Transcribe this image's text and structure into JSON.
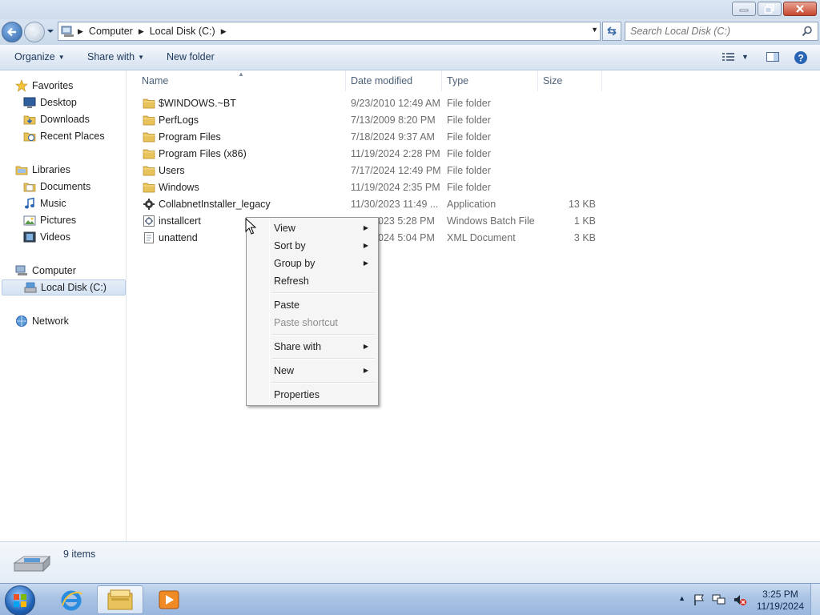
{
  "window": {
    "minimize_icon": "minimize-icon",
    "restore_icon": "restore-icon",
    "close_icon": "close-icon"
  },
  "address": {
    "crumbs": [
      "Computer",
      "Local Disk (C:)"
    ],
    "search_placeholder": "Search Local Disk (C:)"
  },
  "toolbar": {
    "organize": "Organize",
    "share_with": "Share with",
    "new_folder": "New folder"
  },
  "nav": {
    "favorites": "Favorites",
    "desktop": "Desktop",
    "downloads": "Downloads",
    "recent_places": "Recent Places",
    "libraries": "Libraries",
    "documents": "Documents",
    "music": "Music",
    "pictures": "Pictures",
    "videos": "Videos",
    "computer": "Computer",
    "local_disk": "Local Disk (C:)",
    "network": "Network"
  },
  "columns": {
    "name": "Name",
    "date_modified": "Date modified",
    "type": "Type",
    "size": "Size"
  },
  "files": [
    {
      "name": "$WINDOWS.~BT",
      "date": "9/23/2010 12:49 AM",
      "type": "File folder",
      "size": "",
      "icon": "folder-icon"
    },
    {
      "name": "PerfLogs",
      "date": "7/13/2009 8:20 PM",
      "type": "File folder",
      "size": "",
      "icon": "folder-icon"
    },
    {
      "name": "Program Files",
      "date": "7/18/2024 9:37 AM",
      "type": "File folder",
      "size": "",
      "icon": "folder-icon"
    },
    {
      "name": "Program Files (x86)",
      "date": "11/19/2024 2:28 PM",
      "type": "File folder",
      "size": "",
      "icon": "folder-icon"
    },
    {
      "name": "Users",
      "date": "7/17/2024 12:49 PM",
      "type": "File folder",
      "size": "",
      "icon": "folder-icon"
    },
    {
      "name": "Windows",
      "date": "11/19/2024 2:35 PM",
      "type": "File folder",
      "size": "",
      "icon": "folder-icon"
    },
    {
      "name": "CollabnetInstaller_legacy",
      "date": "11/30/2023 11:49 ...",
      "type": "Application",
      "size": "13 KB",
      "icon": "application-icon"
    },
    {
      "name": "installcert",
      "date": "023 5:28 PM",
      "type": "Windows Batch File",
      "size": "1 KB",
      "icon": "batch-file-icon"
    },
    {
      "name": "unattend",
      "date": "024 5:04 PM",
      "type": "XML Document",
      "size": "3 KB",
      "icon": "xml-document-icon"
    }
  ],
  "context_menu": {
    "view": "View",
    "sort_by": "Sort by",
    "group_by": "Group by",
    "refresh": "Refresh",
    "paste": "Paste",
    "paste_shortcut": "Paste shortcut",
    "share_with": "Share with",
    "new": "New",
    "properties": "Properties"
  },
  "status": {
    "item_count": "9 items"
  },
  "taskbar": {
    "time": "3:25 PM",
    "date": "11/19/2024"
  },
  "colors": {
    "accent": "#1e395b",
    "folder": "#e8c25a",
    "selection": "#d4e2f3"
  }
}
